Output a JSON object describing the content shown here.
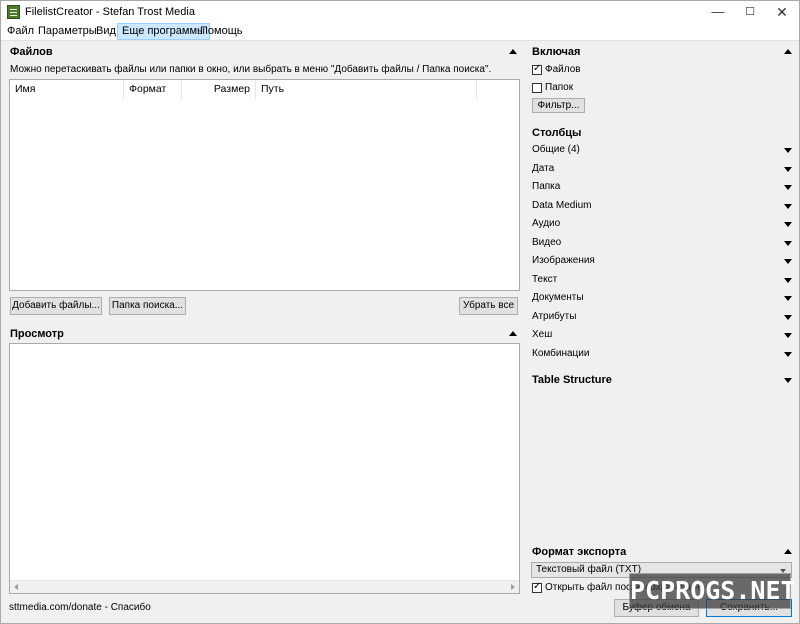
{
  "window": {
    "title": "FilelistCreator - Stefan Trost Media"
  },
  "menu": [
    "Файл",
    "Параметры",
    "Вид",
    "Еще программы",
    "Помощь"
  ],
  "files_pane": {
    "header": "Файлов",
    "hint": "Можно перетаскивать файлы или папки в окно, или выбрать в меню \"Добавить файлы / Папка поиска\".",
    "columns": [
      "Имя",
      "Формат",
      "Размер",
      "Путь"
    ],
    "add_files_button": "Добавить файлы...",
    "search_folder_button": "Папка поиска...",
    "remove_all_button": "Убрать все"
  },
  "preview_pane": {
    "header": "Просмотр"
  },
  "include": {
    "header": "Включая",
    "files_label": "Файлов",
    "files_checked": true,
    "folders_label": "Папок",
    "folders_checked": false,
    "filter_button": "Фильтр..."
  },
  "columns_section": {
    "header": "Столбцы",
    "items": [
      "Общие (4)",
      "Дата",
      "Папка",
      "Data Medium",
      "Аудио",
      "Видео",
      "Изображения",
      "Текст",
      "Документы",
      "Атрибуты",
      "Хеш",
      "Комбинации"
    ]
  },
  "table_structure": {
    "header": "Table Structure"
  },
  "export": {
    "header": "Формат экспорта",
    "format_value": "Текстовый файл (TXT)",
    "open_after_label": "Открыть файл после сохранения",
    "open_after_checked": true,
    "clipboard_button": "Буфер обмена",
    "save_button": "Сохранить..."
  },
  "status_text": "sttmedia.com/donate - Спасибо",
  "watermark": "PCPROGS.NET",
  "icons": {
    "app": "file-list-app-icon",
    "minimize": "minimize-icon",
    "maximize": "maximize-icon",
    "close": "close-icon",
    "collapse": "triangle-up-icon",
    "expand": "triangle-down-icon"
  }
}
